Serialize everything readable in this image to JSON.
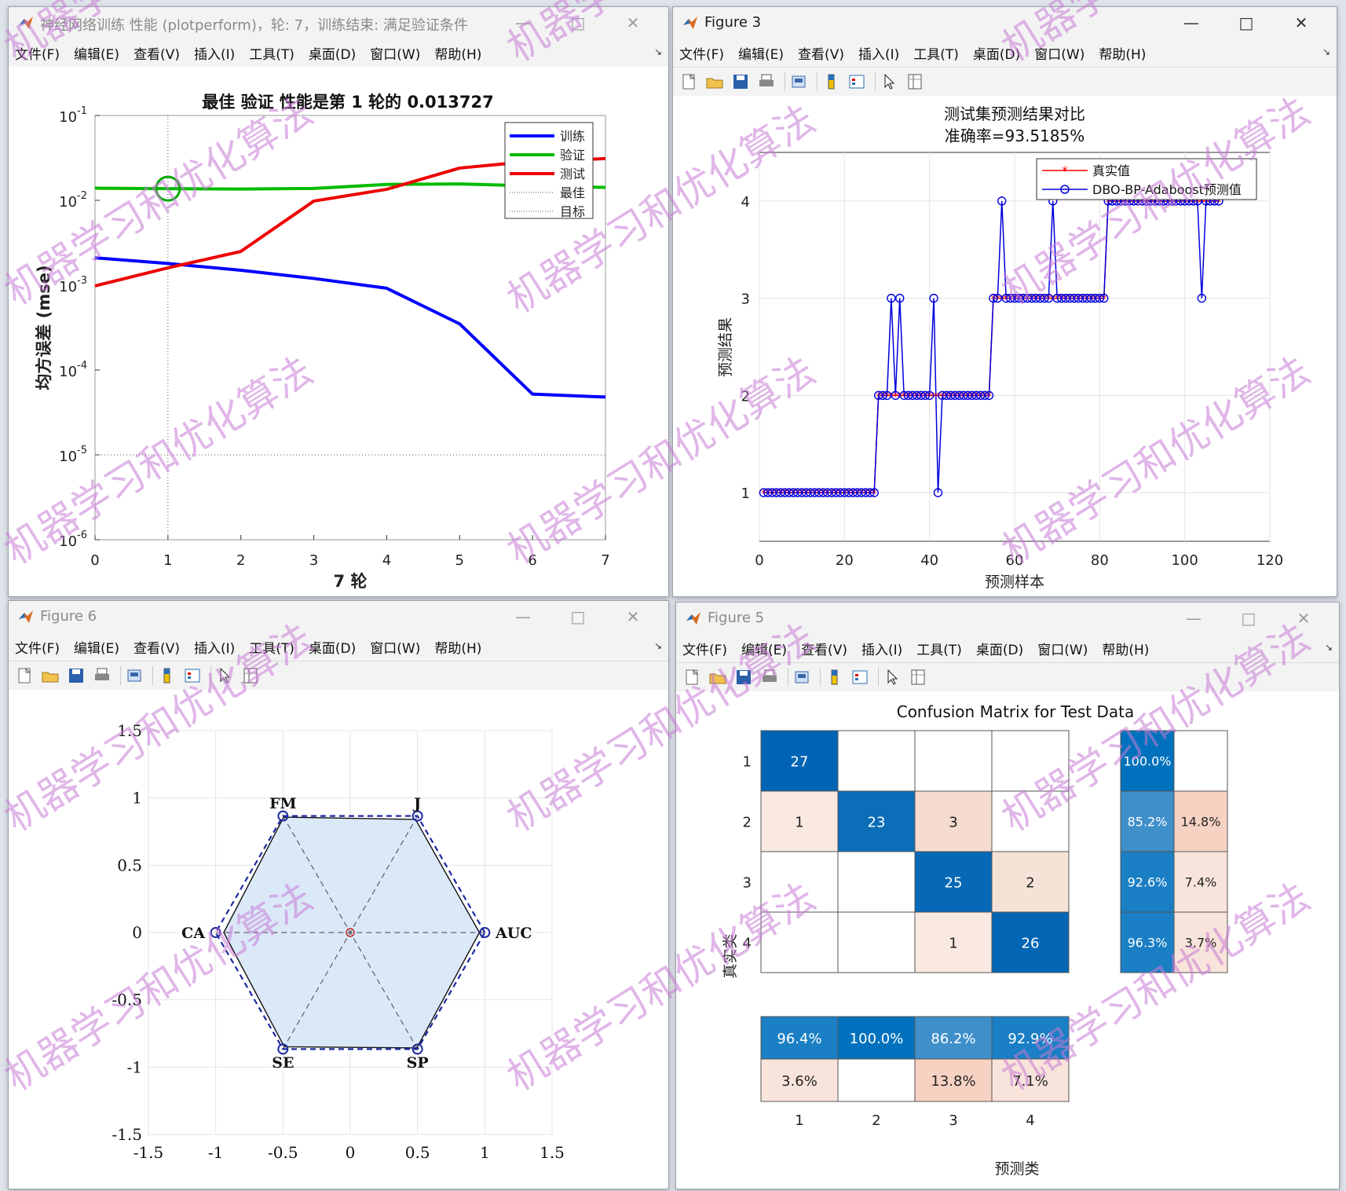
{
  "menus": [
    "文件(F)",
    "编辑(E)",
    "查看(V)",
    "插入(I)",
    "工具(T)",
    "桌面(D)",
    "窗口(W)",
    "帮助(H)"
  ],
  "windows": {
    "perf": {
      "title": "神经网络训练 性能 (plotperform)，轮: 7，训练结束: 满足验证条件"
    },
    "fig3": {
      "title": "Figure 3"
    },
    "fig6": {
      "title": "Figure 6"
    },
    "fig5": {
      "title": "Figure 5"
    }
  },
  "watermark": "机器学习和优化算法",
  "chart_data": [
    {
      "type": "line",
      "window": "perf",
      "title": "最佳 验证 性能是第 1 轮的 0.013727",
      "xlabel": "7 轮",
      "ylabel": "均方误差 (mse)",
      "yscale": "log",
      "xlim": [
        0,
        7
      ],
      "ylim": [
        1e-06,
        0.1
      ],
      "xticks": [
        "0",
        "1",
        "2",
        "3",
        "4",
        "5",
        "6",
        "7"
      ],
      "yticks": [
        {
          "base": "10",
          "exp": "-1"
        },
        {
          "base": "10",
          "exp": "-2"
        },
        {
          "base": "10",
          "exp": "-3"
        },
        {
          "base": "10",
          "exp": "-4"
        },
        {
          "base": "10",
          "exp": "-5"
        },
        {
          "base": "10",
          "exp": "-6"
        }
      ],
      "legend_position": "top-right",
      "series": [
        {
          "name": "训练",
          "color": "#0000ff",
          "x": [
            0,
            1,
            2,
            3,
            4,
            5,
            6,
            7
          ],
          "y": [
            0.0021,
            0.0018,
            0.0015,
            0.0012,
            0.00092,
            0.00035,
            5.2e-05,
            4.8e-05
          ]
        },
        {
          "name": "验证",
          "color": "#00bb00",
          "x": [
            0,
            1,
            2,
            3,
            4,
            5,
            6,
            7
          ],
          "y": [
            0.0139,
            0.013727,
            0.0136,
            0.0138,
            0.0154,
            0.0156,
            0.0148,
            0.0142
          ]
        },
        {
          "name": "测试",
          "color": "#ee0000",
          "x": [
            0,
            1,
            2,
            3,
            4,
            5,
            6,
            7
          ],
          "y": [
            0.00098,
            0.0016,
            0.0025,
            0.0098,
            0.0135,
            0.024,
            0.029,
            0.031
          ]
        },
        {
          "name": "最佳",
          "style": "dotted",
          "x": 1
        },
        {
          "name": "目标",
          "style": "dotted",
          "y": 1e-05
        }
      ],
      "marker": {
        "x": 1,
        "y": 0.013727,
        "color": "#00aa00"
      }
    },
    {
      "type": "line",
      "window": "fig3",
      "title": "测试集预测结果对比",
      "subtitle": "准确率=93.5185%",
      "xlabel": "预测样本",
      "ylabel": "预测结果",
      "xlim": [
        0,
        120
      ],
      "ylim": [
        0.5,
        4.5
      ],
      "xticks": [
        "0",
        "20",
        "40",
        "60",
        "80",
        "100",
        "120"
      ],
      "yticks": [
        "1",
        "2",
        "3",
        "4"
      ],
      "grid": true,
      "legend_position": "top-right",
      "series": [
        {
          "name": "真实值",
          "color": "#ff0000",
          "marker": "*",
          "values": [
            1,
            1,
            1,
            1,
            1,
            1,
            1,
            1,
            1,
            1,
            1,
            1,
            1,
            1,
            1,
            1,
            1,
            1,
            1,
            1,
            1,
            1,
            1,
            1,
            1,
            1,
            1,
            2,
            2,
            2,
            2,
            2,
            2,
            2,
            2,
            2,
            2,
            2,
            2,
            2,
            2,
            2,
            2,
            2,
            2,
            2,
            2,
            2,
            2,
            2,
            2,
            2,
            2,
            2,
            3,
            3,
            3,
            3,
            3,
            3,
            3,
            3,
            3,
            3,
            3,
            3,
            3,
            3,
            3,
            3,
            3,
            3,
            3,
            3,
            3,
            3,
            3,
            3,
            3,
            3,
            3,
            4,
            4,
            4,
            4,
            4,
            4,
            4,
            4,
            4,
            4,
            4,
            4,
            4,
            4,
            4,
            4,
            4,
            4,
            4,
            4,
            4,
            4,
            4,
            4,
            4,
            4,
            4
          ]
        },
        {
          "name": "DBO-BP-Adaboost预测值",
          "color": "#0000dd",
          "marker": "o",
          "values": [
            1,
            1,
            1,
            1,
            1,
            1,
            1,
            1,
            1,
            1,
            1,
            1,
            1,
            1,
            1,
            1,
            1,
            1,
            1,
            1,
            1,
            1,
            1,
            1,
            1,
            1,
            1,
            2,
            2,
            2,
            3,
            2,
            3,
            2,
            2,
            2,
            2,
            2,
            2,
            2,
            3,
            1,
            2,
            2,
            2,
            2,
            2,
            2,
            2,
            2,
            2,
            2,
            2,
            2,
            3,
            3,
            4,
            3,
            3,
            3,
            3,
            3,
            3,
            3,
            3,
            3,
            3,
            3,
            4,
            3,
            3,
            3,
            3,
            3,
            3,
            3,
            3,
            3,
            3,
            3,
            3,
            4,
            4,
            4,
            4,
            4,
            4,
            4,
            4,
            4,
            4,
            4,
            4,
            4,
            4,
            4,
            4,
            4,
            4,
            4,
            4,
            4,
            4,
            3,
            4,
            4,
            4,
            4
          ]
        }
      ]
    },
    {
      "type": "radar",
      "window": "fig6",
      "xlim": [
        -1.5,
        1.5
      ],
      "ylim": [
        -1.5,
        1.5
      ],
      "xticks": [
        "-1.5",
        "-1",
        "-0.5",
        "0",
        "0.5",
        "1",
        "1.5"
      ],
      "yticks": [
        "1.5",
        "1",
        "0.5",
        "0",
        "-0.5",
        "-1",
        "-1.5"
      ],
      "axes": [
        "AUC",
        "J",
        "FM",
        "CA",
        "SE",
        "SP"
      ],
      "values": [
        0.96,
        0.97,
        0.99,
        0.94,
        0.98,
        0.99
      ],
      "reference": [
        1,
        1,
        1,
        1,
        1,
        1
      ]
    },
    {
      "type": "heatmap",
      "window": "fig5",
      "title": "Confusion Matrix for Test Data",
      "xlabel": "预测类",
      "ylabel": "真实类",
      "classes": [
        "1",
        "2",
        "3",
        "4"
      ],
      "matrix": [
        [
          27,
          0,
          0,
          0
        ],
        [
          1,
          23,
          3,
          0
        ],
        [
          0,
          0,
          25,
          2
        ],
        [
          0,
          0,
          1,
          26
        ]
      ],
      "row_summary": [
        [
          "100.0%",
          ""
        ],
        [
          "85.2%",
          "14.8%"
        ],
        [
          "92.6%",
          "7.4%"
        ],
        [
          "96.3%",
          "3.7%"
        ]
      ],
      "col_summary": [
        [
          "96.4%",
          "3.6%"
        ],
        [
          "100.0%",
          ""
        ],
        [
          "86.2%",
          "13.8%"
        ],
        [
          "92.9%",
          "7.1%"
        ]
      ]
    }
  ]
}
